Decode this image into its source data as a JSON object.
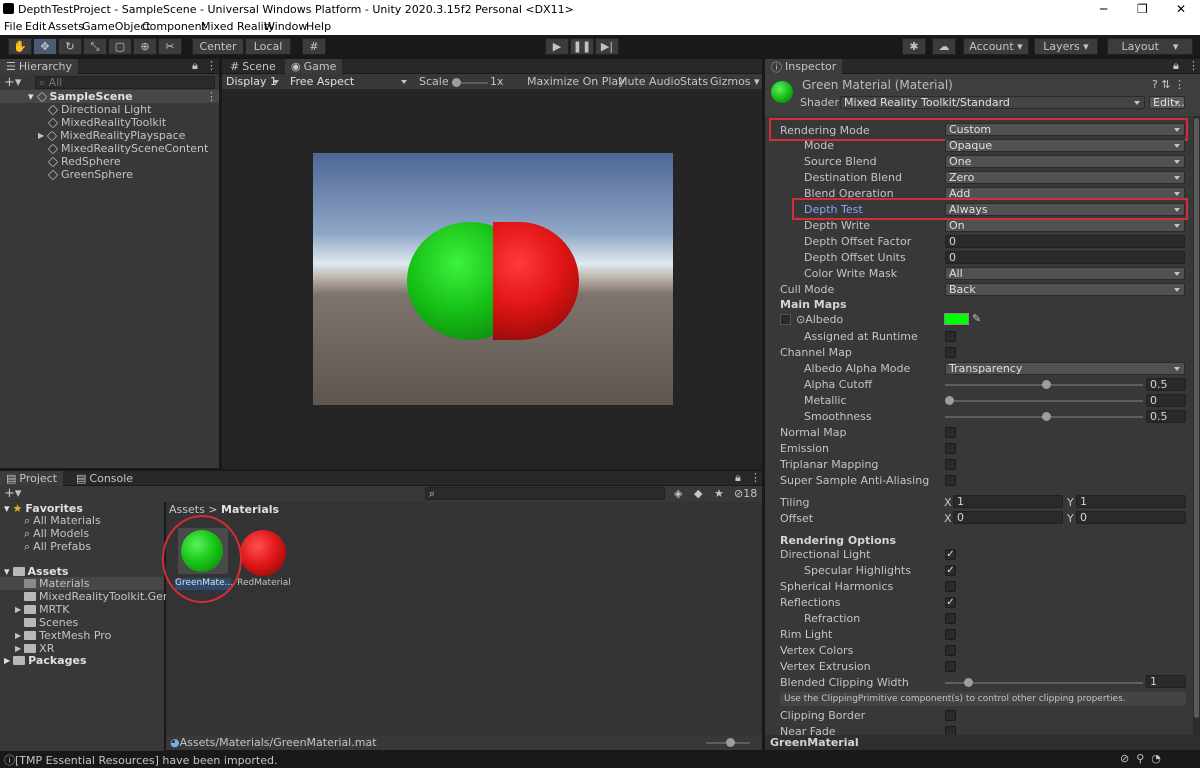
{
  "window": {
    "title": "DepthTestProject - SampleScene - Universal Windows Platform - Unity 2020.3.15f2 Personal <DX11>",
    "minimize": "─",
    "maximize": "❐",
    "close": "✕"
  },
  "menu": [
    "File",
    "Edit",
    "Assets",
    "GameObject",
    "Component",
    "Mixed Reality",
    "Window",
    "Help"
  ],
  "toolbar": {
    "center": "Center",
    "local": "Local",
    "account": "Account",
    "layers": "Layers",
    "layout": "Layout"
  },
  "hierarchy": {
    "tab": "Hierarchy",
    "search_placeholder": "All",
    "scene": "SampleScene",
    "items": [
      "Directional Light",
      "MixedRealityToolkit",
      "MixedRealityPlayspace",
      "MixedRealitySceneContent",
      "RedSphere",
      "GreenSphere"
    ]
  },
  "game": {
    "tab_scene": "Scene",
    "tab_game": "Game",
    "display": "Display 1",
    "aspect": "Free Aspect",
    "scale_label": "Scale",
    "scale_value": "1x",
    "maximize": "Maximize On Play",
    "mute": "Mute Audio",
    "stats": "Stats",
    "gizmos": "Gizmos"
  },
  "project": {
    "tab_project": "Project",
    "tab_console": "Console",
    "favorites": "Favorites",
    "fav_items": [
      "All Materials",
      "All Models",
      "All Prefabs"
    ],
    "assets": "Assets",
    "asset_items": [
      "Materials",
      "MixedRealityToolkit.Generated",
      "MRTK",
      "Scenes",
      "TextMesh Pro",
      "XR"
    ],
    "packages": "Packages",
    "breadcrumb_root": "Assets",
    "breadcrumb_current": "Materials",
    "files": [
      "GreenMate...",
      "RedMaterial"
    ],
    "path": "Assets/Materials/GreenMaterial.mat",
    "hidden_count": "18"
  },
  "inspector": {
    "tab": "Inspector",
    "material_name": "Green Material (Material)",
    "shader_label": "Shader",
    "shader_value": "Mixed Reality Toolkit/Standard",
    "edit": "Edit...",
    "rendering_mode_label": "Rendering Mode",
    "rendering_mode": "Custom",
    "props": [
      {
        "label": "Mode",
        "value": "Opaque",
        "type": "dd"
      },
      {
        "label": "Source Blend",
        "value": "One",
        "type": "dd"
      },
      {
        "label": "Destination Blend",
        "value": "Zero",
        "type": "dd"
      },
      {
        "label": "Blend Operation",
        "value": "Add",
        "type": "dd"
      },
      {
        "label": "Depth Test",
        "value": "Always",
        "type": "dd"
      },
      {
        "label": "Depth Write",
        "value": "On",
        "type": "dd"
      },
      {
        "label": "Depth Offset Factor",
        "value": "0",
        "type": "fld"
      },
      {
        "label": "Depth Offset Units",
        "value": "0",
        "type": "fld"
      },
      {
        "label": "Color Write Mask",
        "value": "All",
        "type": "dd"
      }
    ],
    "cull_mode_label": "Cull Mode",
    "cull_mode": "Back",
    "main_maps": "Main Maps",
    "albedo": "Albedo",
    "albedo_color": "#00ff00",
    "assigned_runtime": "Assigned at Runtime",
    "channel_map": "Channel Map",
    "albedo_alpha_mode_label": "Albedo Alpha Mode",
    "albedo_alpha_mode": "Transparency",
    "sliders": [
      {
        "label": "Alpha Cutoff",
        "value": "0.5",
        "frac": 0.5
      },
      {
        "label": "Metallic",
        "value": "0",
        "frac": 0
      },
      {
        "label": "Smoothness",
        "value": "0.5",
        "frac": 0.5
      }
    ],
    "toggles": [
      {
        "label": "Normal Map",
        "checked": false
      },
      {
        "label": "Emission",
        "checked": false
      },
      {
        "label": "Triplanar Mapping",
        "checked": false
      },
      {
        "label": "Super Sample Anti-Aliasing",
        "checked": false
      }
    ],
    "tiling_label": "Tiling",
    "offset_label": "Offset",
    "tiling_x": "1",
    "tiling_y": "1",
    "offset_x": "0",
    "offset_y": "0",
    "x": "X",
    "y": "Y",
    "rendering_options": "Rendering Options",
    "ro_toggles": [
      {
        "label": "Directional Light",
        "checked": true,
        "indent": false
      },
      {
        "label": "Specular Highlights",
        "checked": true,
        "indent": true
      },
      {
        "label": "Spherical Harmonics",
        "checked": false,
        "indent": false
      },
      {
        "label": "Reflections",
        "checked": true,
        "indent": false
      },
      {
        "label": "Refraction",
        "checked": false,
        "indent": true
      },
      {
        "label": "Rim Light",
        "checked": false,
        "indent": false
      },
      {
        "label": "Vertex Colors",
        "checked": false,
        "indent": false
      },
      {
        "label": "Vertex Extrusion",
        "checked": false,
        "indent": false
      }
    ],
    "blended_clipping_label": "Blended Clipping Width",
    "blended_clipping_value": "1",
    "clip_help": "Use the ClippingPrimitive component(s) to control other clipping properties.",
    "clipping_border": "Clipping Border",
    "near_fade": "Near Fade",
    "footer": "GreenMaterial"
  },
  "status": "[TMP Essential Resources] have been imported.",
  "colors": {
    "green": "#1ec81e",
    "red": "#e31a1a",
    "highlight": "#d32d35"
  }
}
